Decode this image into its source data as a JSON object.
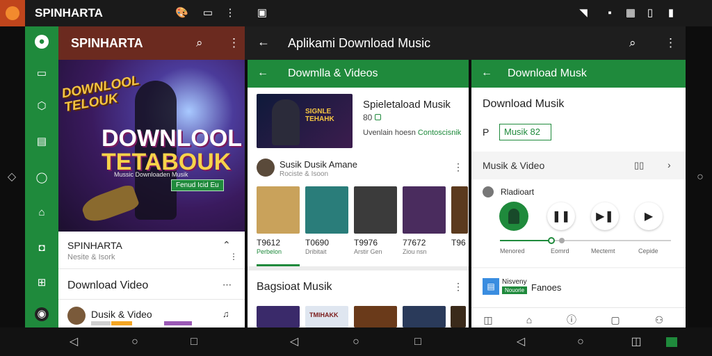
{
  "statusbar": {
    "app_title": "SPINHARTA",
    "icons_left": [
      "palette-icon",
      "window-icon",
      "overflow-icon",
      "screenshot-icon"
    ],
    "icons_right": [
      "wifi-icon",
      "sim-icon",
      "signal-icon",
      "vibrate-icon",
      "battery-icon"
    ]
  },
  "panel1": {
    "title": "SPINHARTA",
    "rail_icons": [
      "logo-icon",
      "message-icon",
      "bag-icon",
      "folder-icon",
      "chat-icon",
      "home-icon",
      "camera-icon",
      "grid-icon",
      "record-icon"
    ],
    "hero": {
      "logo": "DOWNLOOL TELOUK",
      "big_line1": "DOWNLOOL",
      "big_line2": "TETABOUK",
      "sub": "Mussic Downloaden Musik",
      "button": "Fenud Icid Eu"
    },
    "item1": {
      "title": "SPINHARTA",
      "subtitle": "Nesite & Isork"
    },
    "section": "Download Video",
    "item2": {
      "title": "Dusik & Video"
    }
  },
  "panel2": {
    "title": "Aplikami Download Music",
    "left": {
      "header": "Dowmlla & Videos",
      "feature": {
        "title": "Spieletaload Musik",
        "count": "80",
        "meta": "Uvenlain hoesn",
        "meta_link": "Contoscisnik"
      },
      "feature_thumb_text": "SIGNLE TEHAHK",
      "artist": {
        "name": "Susik Dusik Amane",
        "sub": "Rociste & Isoon"
      },
      "tiles": [
        {
          "num": "T9612",
          "label": "Perbelon",
          "active": true,
          "color": "#c9a25b"
        },
        {
          "num": "T0690",
          "label": "Dribitait",
          "active": false,
          "color": "#2a7d7a"
        },
        {
          "num": "T9976",
          "label": "Arstir Gen",
          "active": false,
          "color": "#3b3b3b"
        },
        {
          "num": "77672",
          "label": "Ziou nsn",
          "active": false,
          "color": "#4a2c5e"
        },
        {
          "num": "T96",
          "label": "",
          "active": false,
          "color": "#5b3a1e"
        }
      ],
      "section": "Bagsioat Musik",
      "row2_text": "TMIHAKK"
    },
    "right": {
      "header": "Download Musk",
      "title": "Download Musik",
      "field_icon": "P",
      "field_value": "Musik 82",
      "filter": "Musik & Video",
      "player_label": "Rladioart",
      "steps": [
        "Menored",
        "Eomrd",
        "Mectemt",
        "Cepide"
      ],
      "progress": 0.3,
      "promo_title": "Nisveny",
      "promo_badge": "Nouorie",
      "promo_text": "Fanoes"
    }
  },
  "nav": {
    "icons": [
      "back-icon",
      "home-icon",
      "recents-icon",
      "back-icon",
      "home-icon",
      "recents-icon",
      "back-icon",
      "home-icon",
      "recents-icon",
      "screenshot-icon"
    ]
  }
}
